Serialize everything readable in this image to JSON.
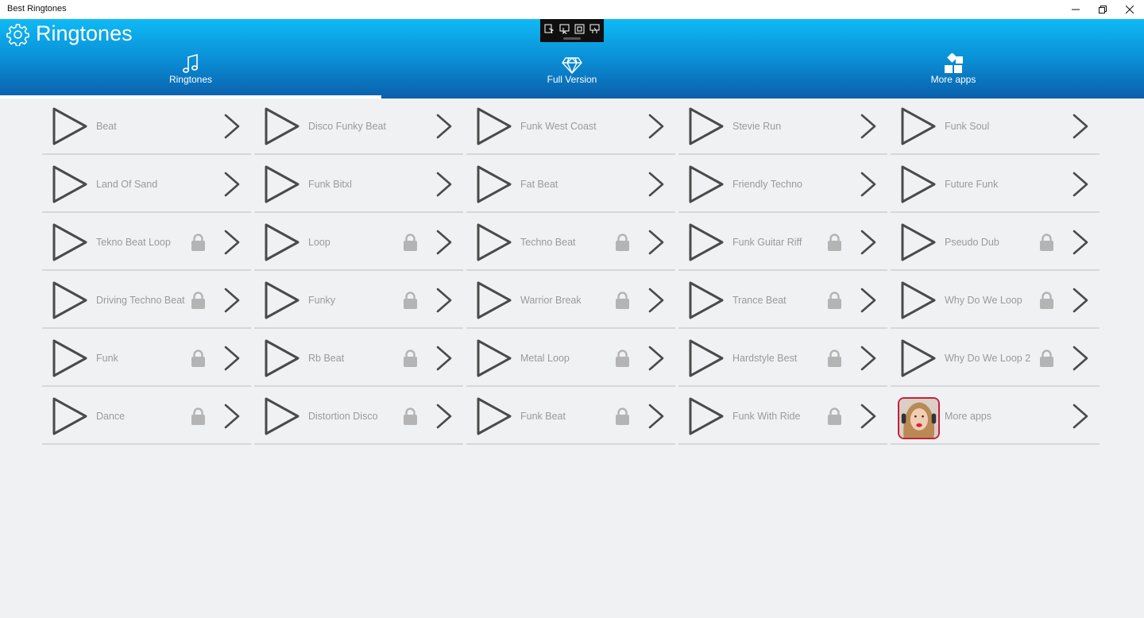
{
  "window": {
    "title": "Best Ringtones"
  },
  "header": {
    "title": "Ringtones",
    "settings_icon": "gear-icon"
  },
  "tabs": [
    {
      "label": "Ringtones",
      "icon": "music-note-icon",
      "active": true
    },
    {
      "label": "Full Version",
      "icon": "diamond-icon",
      "active": false
    },
    {
      "label": "More apps",
      "icon": "apps-grid-icon",
      "active": false
    }
  ],
  "ringtones": [
    {
      "label": "Beat",
      "locked": false
    },
    {
      "label": "Disco Funky Beat",
      "locked": false
    },
    {
      "label": "Funk West Coast",
      "locked": false
    },
    {
      "label": "Stevie Run",
      "locked": false
    },
    {
      "label": "Funk Soul",
      "locked": false
    },
    {
      "label": "Land Of Sand",
      "locked": false
    },
    {
      "label": "Funk Bitxl",
      "locked": false
    },
    {
      "label": "Fat Beat",
      "locked": false
    },
    {
      "label": "Friendly Techno",
      "locked": false
    },
    {
      "label": "Future Funk",
      "locked": false
    },
    {
      "label": "Tekno Beat Loop",
      "locked": true
    },
    {
      "label": "Loop",
      "locked": true
    },
    {
      "label": "Techno Beat",
      "locked": true
    },
    {
      "label": "Funk Guitar Riff",
      "locked": true
    },
    {
      "label": "Pseudo Dub",
      "locked": true
    },
    {
      "label": "Driving Techno Beat",
      "locked": true
    },
    {
      "label": "Funky",
      "locked": true
    },
    {
      "label": "Warrior Break",
      "locked": true
    },
    {
      "label": "Trance Beat",
      "locked": true
    },
    {
      "label": "Why Do We Loop",
      "locked": true
    },
    {
      "label": "Funk",
      "locked": true
    },
    {
      "label": "Rb Beat",
      "locked": true
    },
    {
      "label": "Metal Loop",
      "locked": true
    },
    {
      "label": "Hardstyle Best",
      "locked": true
    },
    {
      "label": "Why Do We Loop 2",
      "locked": true
    },
    {
      "label": "Dance",
      "locked": true
    },
    {
      "label": "Distortion Disco",
      "locked": true
    },
    {
      "label": "Funk Beat",
      "locked": true
    },
    {
      "label": "Funk With Ride",
      "locked": true
    }
  ],
  "more_apps": {
    "label": "More apps",
    "icon": "app-thumbnail"
  },
  "colors": {
    "header_top": "#0fbaf5",
    "header_bottom": "#0b5fab",
    "background": "#f0f1f3",
    "label": "#9a9a9c",
    "icon": "#4a4a4a",
    "lock": "#b4b4b4"
  }
}
